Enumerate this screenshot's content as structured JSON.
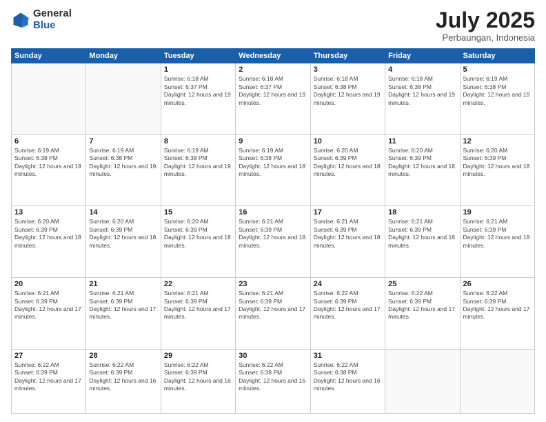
{
  "logo": {
    "general": "General",
    "blue": "Blue"
  },
  "header": {
    "month": "July 2025",
    "location": "Perbaungan, Indonesia"
  },
  "weekdays": [
    "Sunday",
    "Monday",
    "Tuesday",
    "Wednesday",
    "Thursday",
    "Friday",
    "Saturday"
  ],
  "weeks": [
    [
      {
        "num": "",
        "info": ""
      },
      {
        "num": "",
        "info": ""
      },
      {
        "num": "1",
        "info": "Sunrise: 6:18 AM\nSunset: 6:37 PM\nDaylight: 12 hours and 19 minutes."
      },
      {
        "num": "2",
        "info": "Sunrise: 6:18 AM\nSunset: 6:37 PM\nDaylight: 12 hours and 19 minutes."
      },
      {
        "num": "3",
        "info": "Sunrise: 6:18 AM\nSunset: 6:38 PM\nDaylight: 12 hours and 19 minutes."
      },
      {
        "num": "4",
        "info": "Sunrise: 6:18 AM\nSunset: 6:38 PM\nDaylight: 12 hours and 19 minutes."
      },
      {
        "num": "5",
        "info": "Sunrise: 6:19 AM\nSunset: 6:38 PM\nDaylight: 12 hours and 19 minutes."
      }
    ],
    [
      {
        "num": "6",
        "info": "Sunrise: 6:19 AM\nSunset: 6:38 PM\nDaylight: 12 hours and 19 minutes."
      },
      {
        "num": "7",
        "info": "Sunrise: 6:19 AM\nSunset: 6:38 PM\nDaylight: 12 hours and 19 minutes."
      },
      {
        "num": "8",
        "info": "Sunrise: 6:19 AM\nSunset: 6:38 PM\nDaylight: 12 hours and 19 minutes."
      },
      {
        "num": "9",
        "info": "Sunrise: 6:19 AM\nSunset: 6:38 PM\nDaylight: 12 hours and 18 minutes."
      },
      {
        "num": "10",
        "info": "Sunrise: 6:20 AM\nSunset: 6:39 PM\nDaylight: 12 hours and 18 minutes."
      },
      {
        "num": "11",
        "info": "Sunrise: 6:20 AM\nSunset: 6:39 PM\nDaylight: 12 hours and 18 minutes."
      },
      {
        "num": "12",
        "info": "Sunrise: 6:20 AM\nSunset: 6:39 PM\nDaylight: 12 hours and 18 minutes."
      }
    ],
    [
      {
        "num": "13",
        "info": "Sunrise: 6:20 AM\nSunset: 6:39 PM\nDaylight: 12 hours and 18 minutes."
      },
      {
        "num": "14",
        "info": "Sunrise: 6:20 AM\nSunset: 6:39 PM\nDaylight: 12 hours and 18 minutes."
      },
      {
        "num": "15",
        "info": "Sunrise: 6:20 AM\nSunset: 6:39 PM\nDaylight: 12 hours and 18 minutes."
      },
      {
        "num": "16",
        "info": "Sunrise: 6:21 AM\nSunset: 6:39 PM\nDaylight: 12 hours and 18 minutes."
      },
      {
        "num": "17",
        "info": "Sunrise: 6:21 AM\nSunset: 6:39 PM\nDaylight: 12 hours and 18 minutes."
      },
      {
        "num": "18",
        "info": "Sunrise: 6:21 AM\nSunset: 6:39 PM\nDaylight: 12 hours and 18 minutes."
      },
      {
        "num": "19",
        "info": "Sunrise: 6:21 AM\nSunset: 6:39 PM\nDaylight: 12 hours and 18 minutes."
      }
    ],
    [
      {
        "num": "20",
        "info": "Sunrise: 6:21 AM\nSunset: 6:39 PM\nDaylight: 12 hours and 17 minutes."
      },
      {
        "num": "21",
        "info": "Sunrise: 6:21 AM\nSunset: 6:39 PM\nDaylight: 12 hours and 17 minutes."
      },
      {
        "num": "22",
        "info": "Sunrise: 6:21 AM\nSunset: 6:39 PM\nDaylight: 12 hours and 17 minutes."
      },
      {
        "num": "23",
        "info": "Sunrise: 6:21 AM\nSunset: 6:39 PM\nDaylight: 12 hours and 17 minutes."
      },
      {
        "num": "24",
        "info": "Sunrise: 6:22 AM\nSunset: 6:39 PM\nDaylight: 12 hours and 17 minutes."
      },
      {
        "num": "25",
        "info": "Sunrise: 6:22 AM\nSunset: 6:39 PM\nDaylight: 12 hours and 17 minutes."
      },
      {
        "num": "26",
        "info": "Sunrise: 6:22 AM\nSunset: 6:39 PM\nDaylight: 12 hours and 17 minutes."
      }
    ],
    [
      {
        "num": "27",
        "info": "Sunrise: 6:22 AM\nSunset: 6:39 PM\nDaylight: 12 hours and 17 minutes."
      },
      {
        "num": "28",
        "info": "Sunrise: 6:22 AM\nSunset: 6:39 PM\nDaylight: 12 hours and 16 minutes."
      },
      {
        "num": "29",
        "info": "Sunrise: 6:22 AM\nSunset: 6:39 PM\nDaylight: 12 hours and 16 minutes."
      },
      {
        "num": "30",
        "info": "Sunrise: 6:22 AM\nSunset: 6:38 PM\nDaylight: 12 hours and 16 minutes."
      },
      {
        "num": "31",
        "info": "Sunrise: 6:22 AM\nSunset: 6:38 PM\nDaylight: 12 hours and 16 minutes."
      },
      {
        "num": "",
        "info": ""
      },
      {
        "num": "",
        "info": ""
      }
    ]
  ]
}
